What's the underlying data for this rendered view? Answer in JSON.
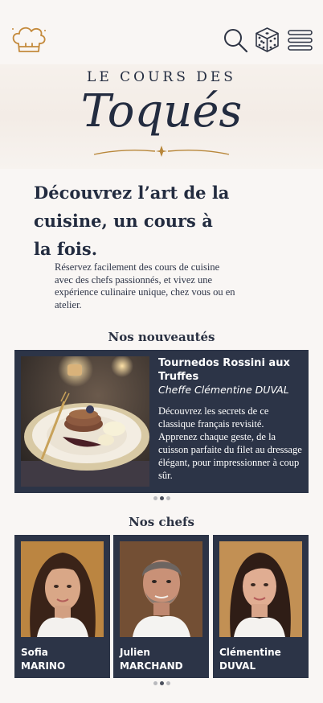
{
  "header": {
    "logo_icon": "chef-hat-icon",
    "search_icon": "search-icon",
    "dice_icon": "dice-icon",
    "menu_icon": "hamburger-menu-icon"
  },
  "brand": {
    "line1": "LE COURS DES",
    "line2": "Toqués"
  },
  "hero": {
    "headline": "Découvrez l’art de la cuisine, un cours à la fois.",
    "intro": "Réservez facilement des cours de cuisine avec des chefs passionnés, et vivez une expérience culinaire unique, chez vous ou en atelier."
  },
  "novelties": {
    "title": "Nos nouveautés",
    "course": {
      "title": "Tournedos Rossini aux Truffes",
      "chef": "Cheffe Clémentine DUVAL",
      "description": "Découvrez les secrets de ce classique français revisité. Apprenez chaque geste, de la cuisson parfaite du filet au dressage élégant, pour impressionner à coup sûr."
    },
    "pagination": {
      "count": 3,
      "active": 1
    }
  },
  "chefs": {
    "title": "Nos chefs",
    "items": [
      {
        "first": "Sofia",
        "last": "MARINO"
      },
      {
        "first": "Julien",
        "last": "MARCHAND"
      },
      {
        "first": "Clémentine",
        "last": "DUVAL"
      }
    ],
    "pagination": {
      "count": 3,
      "active": 1
    }
  },
  "colors": {
    "background": "#f9f6f4",
    "navy": "#2c3447",
    "gold": "#b8873a"
  }
}
